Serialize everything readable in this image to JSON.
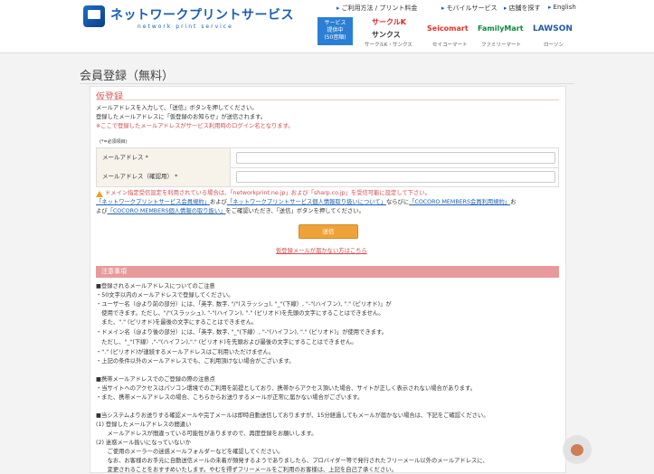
{
  "header": {
    "logo_title": "ネットワークプリントサービス",
    "logo_sub": "network print service",
    "nav": [
      "ご利用方法 / プリント料金",
      "モバイルサービス",
      "店舗を探す",
      "English"
    ],
    "badge": [
      "サービス",
      "提供中",
      "(50音順)"
    ],
    "stores": [
      {
        "logo": "サークルK",
        "logo2": "サンクス",
        "label": "サークルK・サンクス"
      },
      {
        "logo": "Seicomart",
        "label": "セイコーマート"
      },
      {
        "logo": "FamilyMart",
        "label": "ファミリーマート"
      },
      {
        "logo": "LAWSON",
        "label": "ローソン"
      }
    ]
  },
  "page_title": "会員登録（無料）",
  "section": {
    "heading": "仮登録",
    "intro1": "メールアドレスを入力して、「送信」ボタンを押してください。",
    "intro2": "登録したメールアドレスに「仮登録のお知らせ」が送信されます。",
    "intro3": "※ここで登録したメールアドレスがサービス利用時のログイン名となります。",
    "required_note": "(*=必須項目)"
  },
  "form": {
    "email_label": "メールアドレス *",
    "email_confirm_label": "メールアドレス（確認用） *",
    "email_value": "",
    "email_confirm_value": ""
  },
  "notice": {
    "line1": "ドメイン指定受信設定を利用されている場合は、「networkprint.ne.jp」および「sharp.co.jp」を受信可能に設定して下さい。",
    "link1": "「ネットワークプリントサービス会員規約」",
    "and1": "および",
    "link2": "「ネットワークプリントサービス個人情報取り扱いについて」",
    "and2": "ならびに",
    "link3": "「COCORO MEMBERS会員利用規約」",
    "and3": "お",
    "line3a": "よび",
    "link4": "「COCORO MEMBERS個人情報の取り扱い」",
    "line3b": "をご確認いただき、「送信」ボタンを押してください。"
  },
  "submit_label": "送信",
  "no_mail_link": "仮登録メールが届かない方はこちら",
  "notes": {
    "heading": "注意事項",
    "lines": [
      "■登録されるメールアドレスについてのご注意",
      "・50文字以内のメールアドレスで登録してください。",
      "・ユーザー名（@より前の部分）には、「英字, 数字, \"/\"(スラッシュ), \"_\"(下線）, \"-\"(ハイフン), \".\" (ピリオド)」が",
      "　使用できます。ただし、\"/\"(スラッシュ), \"-\"(ハイフン), \".\" (ピリオド)を先頭の文字にすることはできません。",
      "　また、\".\" (ピリオド)を最後の文字にすることはできません。",
      "・ドメイン名（@より後の部分）には、「英字, 数字, \"_\"(下線）, \"-\"(ハイフン), \".\" (ピリオド)」が使用できます。",
      "　ただし、\"_\"(下線）,\"-\"(ハイフン),\".\" (ピリオド)を先頭および最後の文字にすることはできません。",
      "・\".\" (ピリオド)が連続するメールアドレスはご利用いただけません。",
      "・上記の条件以外のメールアドレスでも、ご利用頂けない場合がございます。",
      "",
      "■携帯メールアドレスでのご登録の際の注意点",
      "・当サイトへのアクセスはパソコン環境でのご利用を前提としており、携帯からアクセス頂いた場合、サイトが正しく表示されない場合があります。",
      "・また、携帯メールアドレスの場合、こちらからお送りするメールが正常に届かない場合がございます。",
      "",
      "■当システムよりお送りする確認メールや完了メールは即時自動送信しておりますが、15分経過してもメールが届かない場合は、下記をご確認ください。",
      "(1) 登録したメールアドレスの間違い",
      "　　メールアドレスが間違っている可能性がありますので、再度登録をお願いします。",
      "(2) 迷惑メール扱いになっていないか",
      "　　ご使用のメーラーの迷惑メールフォルダーなどを確認してください。",
      "　　なお、お客様のお手元に自動送信メールの未着が頻発するようでありましたら、プロバイダー等で発行されたフリーメール以外のメールアドレスに、",
      "　　変更されることをおすすめいたします。やむを得ずフリーメールをご利用のお客様は、上記を自己了承ください。"
    ]
  }
}
